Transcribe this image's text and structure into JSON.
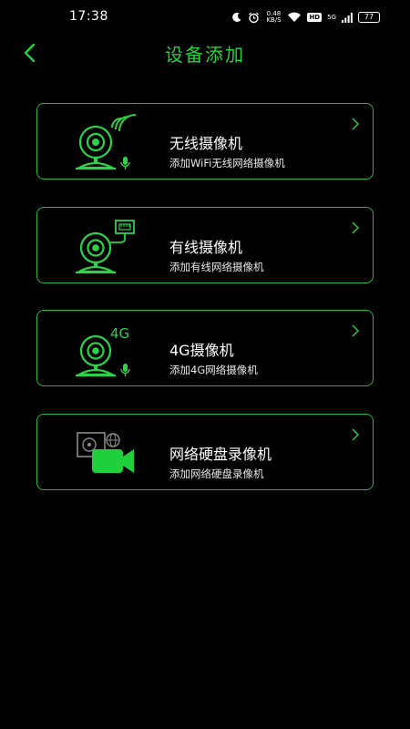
{
  "status_bar": {
    "time": "17:38",
    "net_speed_value": "0.48",
    "net_speed_unit": "KB/S",
    "hd": "HD",
    "signal_label": "5G",
    "battery": "77"
  },
  "header": {
    "title": "设备添加"
  },
  "devices": [
    {
      "title": "无线摄像机",
      "subtitle": "添加WiFi无线网络摄像机",
      "icon": "wireless-camera-icon"
    },
    {
      "title": "有线摄像机",
      "subtitle": "添加有线网络摄像机",
      "icon": "wired-camera-icon"
    },
    {
      "title": "4G摄像机",
      "subtitle": "添加4G网络摄像机",
      "icon": "4g-camera-icon",
      "badge": "4G"
    },
    {
      "title": "网络硬盘录像机",
      "subtitle": "添加网络硬盘录像机",
      "icon": "nvr-icon"
    }
  ],
  "colors": {
    "accent": "#21d33f",
    "card_border": "#29b63e",
    "background": "#000000"
  }
}
